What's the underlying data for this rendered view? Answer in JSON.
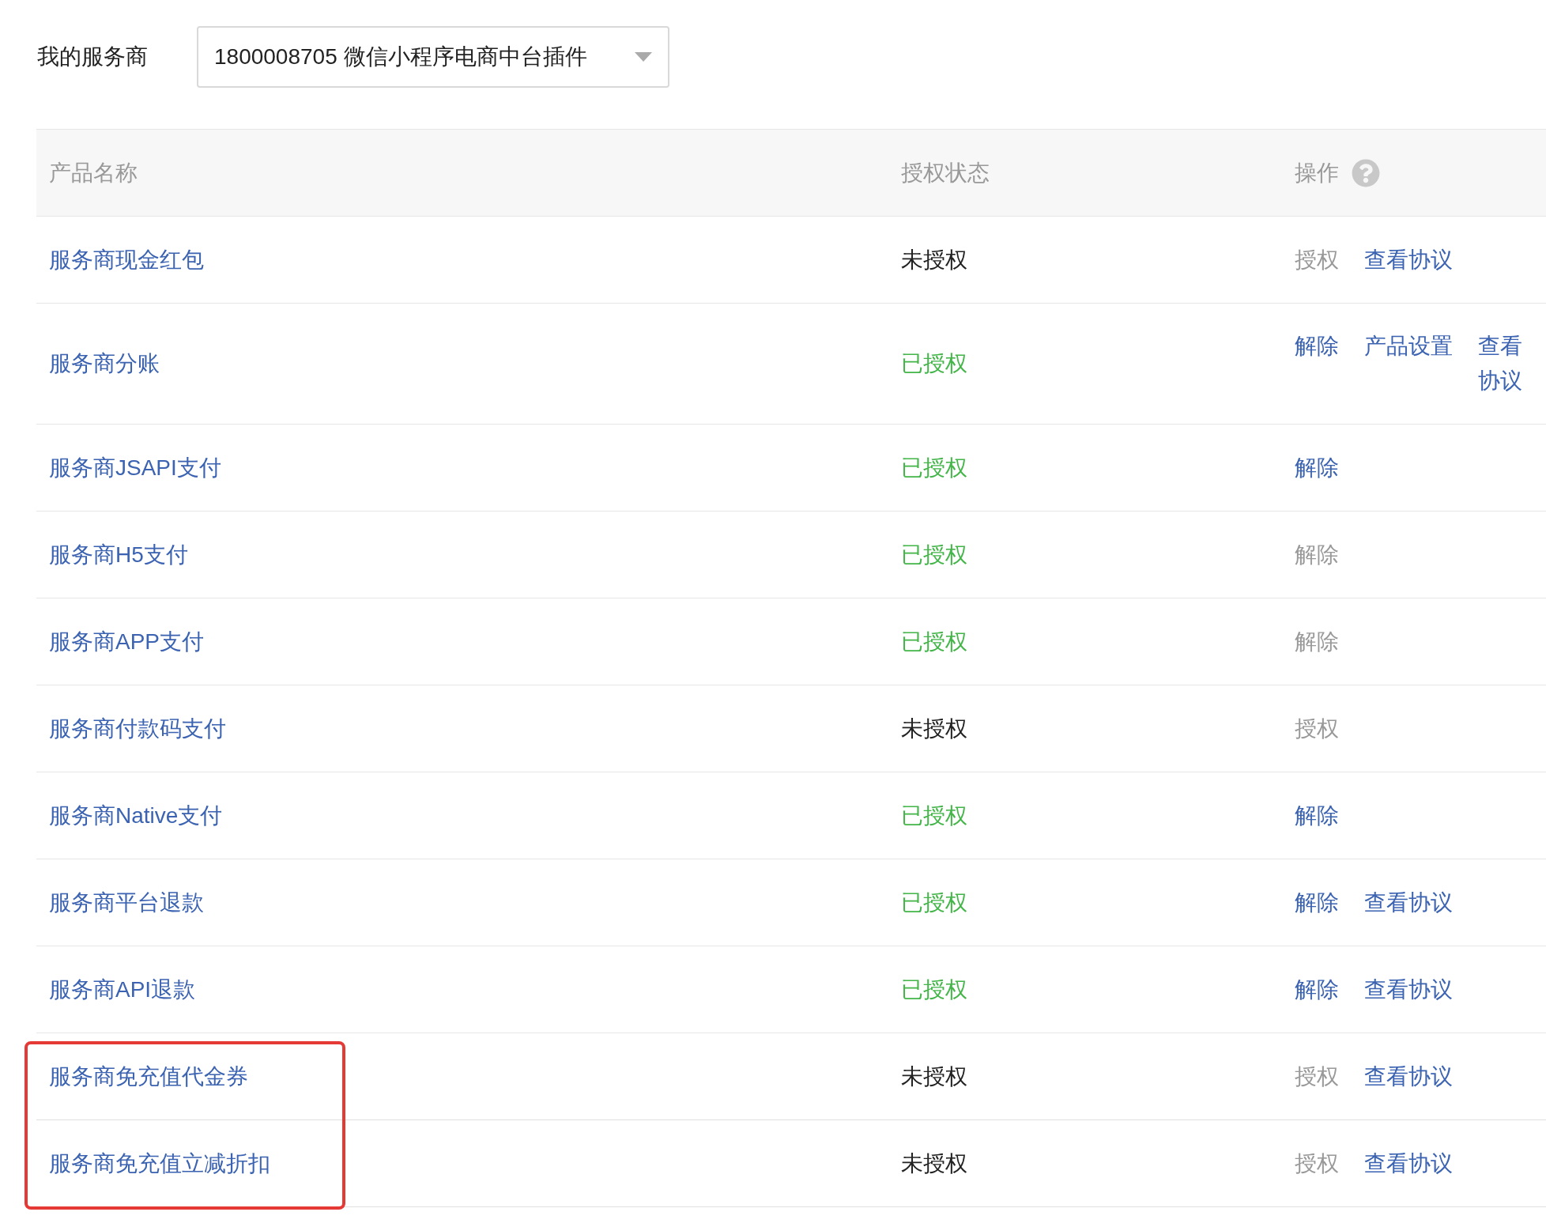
{
  "provider": {
    "label": "我的服务商",
    "value": "1800008705 微信小程序电商中台插件"
  },
  "table": {
    "columns": [
      "产品名称",
      "授权状态",
      "操作"
    ],
    "rows": [
      {
        "name": "服务商现金红包",
        "status": "未授权",
        "authorized": false,
        "highlighted": false,
        "actions": [
          {
            "label": "授权",
            "disabled": true
          },
          {
            "label": "查看协议",
            "disabled": false
          }
        ]
      },
      {
        "name": "服务商分账",
        "status": "已授权",
        "authorized": true,
        "highlighted": false,
        "actions": [
          {
            "label": "解除",
            "disabled": false
          },
          {
            "label": "产品设置",
            "disabled": false
          },
          {
            "label": "查看协议",
            "disabled": false
          }
        ]
      },
      {
        "name": "服务商JSAPI支付",
        "status": "已授权",
        "authorized": true,
        "highlighted": false,
        "actions": [
          {
            "label": "解除",
            "disabled": false
          }
        ]
      },
      {
        "name": "服务商H5支付",
        "status": "已授权",
        "authorized": true,
        "highlighted": false,
        "actions": [
          {
            "label": "解除",
            "disabled": true
          }
        ]
      },
      {
        "name": "服务商APP支付",
        "status": "已授权",
        "authorized": true,
        "highlighted": false,
        "actions": [
          {
            "label": "解除",
            "disabled": true
          }
        ]
      },
      {
        "name": "服务商付款码支付",
        "status": "未授权",
        "authorized": false,
        "highlighted": false,
        "actions": [
          {
            "label": "授权",
            "disabled": true
          }
        ]
      },
      {
        "name": "服务商Native支付",
        "status": "已授权",
        "authorized": true,
        "highlighted": false,
        "actions": [
          {
            "label": "解除",
            "disabled": false
          }
        ]
      },
      {
        "name": "服务商平台退款",
        "status": "已授权",
        "authorized": true,
        "highlighted": false,
        "actions": [
          {
            "label": "解除",
            "disabled": false
          },
          {
            "label": "查看协议",
            "disabled": false
          }
        ]
      },
      {
        "name": "服务商API退款",
        "status": "已授权",
        "authorized": true,
        "highlighted": false,
        "actions": [
          {
            "label": "解除",
            "disabled": false
          },
          {
            "label": "查看协议",
            "disabled": false
          }
        ]
      },
      {
        "name": "服务商免充值代金券",
        "status": "未授权",
        "authorized": false,
        "highlighted": true,
        "actions": [
          {
            "label": "授权",
            "disabled": true
          },
          {
            "label": "查看协议",
            "disabled": false
          }
        ]
      },
      {
        "name": "服务商免充值立减折扣",
        "status": "未授权",
        "authorized": false,
        "highlighted": true,
        "actions": [
          {
            "label": "授权",
            "disabled": true
          },
          {
            "label": "查看协议",
            "disabled": false
          }
        ]
      }
    ]
  }
}
